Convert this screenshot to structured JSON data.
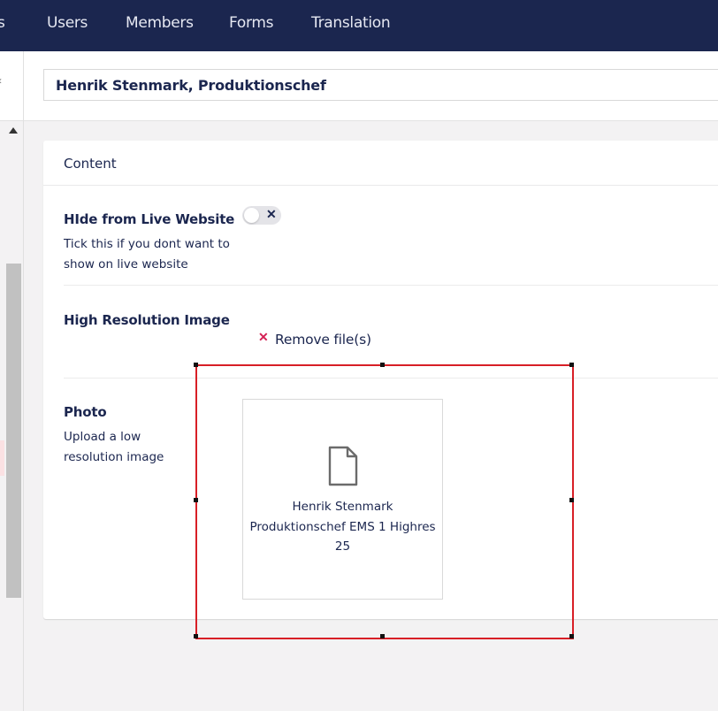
{
  "nav": {
    "items": [
      "s",
      "Users",
      "Members",
      "Forms",
      "Translation"
    ]
  },
  "header": {
    "name_value": "Henrik Stenmark, Produktionschef"
  },
  "panel": {
    "title": "Content",
    "hide": {
      "label": "HIde from Live Website",
      "description": "Tick this if you dont want to show on live website",
      "toggle_state": "off"
    },
    "high_res": {
      "label": "High Resolution Image",
      "remove_label": "Remove file(s)"
    },
    "photo": {
      "label": "Photo",
      "description": "Upload a low resolution image",
      "file_name": "Henrik Stenmark Produktionschef EMS 1 Highres 25"
    }
  },
  "colors": {
    "nav_bg": "#1b264f",
    "text": "#1b264f",
    "remove_x": "#d42054",
    "selection": "#d81f26"
  },
  "icons": {
    "toggle": "close-icon",
    "remove": "close-icon",
    "file": "file-icon",
    "scroll": "chevron-up-icon"
  }
}
